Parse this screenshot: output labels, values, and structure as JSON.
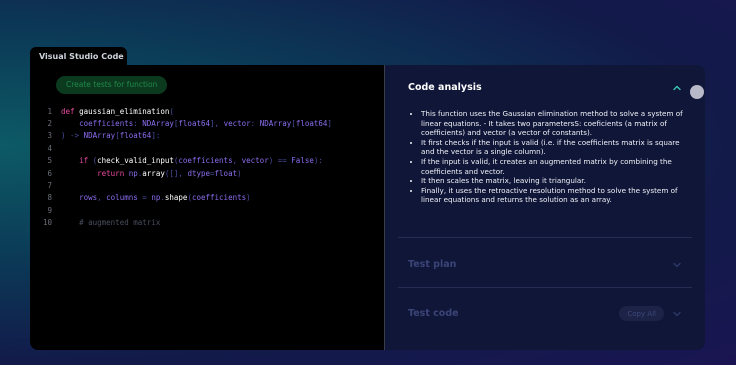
{
  "window": {
    "title": "Visual Studio Code"
  },
  "editor": {
    "create_button_label": "Create tests for function",
    "line_numbers": [
      "1",
      "2",
      "3",
      "4",
      "5",
      "6",
      "7",
      "8",
      "9",
      "10"
    ],
    "line1": {
      "kw": "def",
      "name": "gaussian_elimination",
      "paren": "("
    },
    "line2": {
      "p1": "coefficients",
      "c1": ":",
      "t1": "NDArray",
      "b1": "[",
      "t2": "float64",
      "b2": "]",
      "comma": ",",
      "p2": "vector",
      "c2": ":",
      "t3": "NDArray",
      "b3": "[",
      "t4": "float64",
      "b4": "]"
    },
    "line3": {
      "close": ")",
      "arrow": "->",
      "t1": "NDArray",
      "b1": "[",
      "t2": "float64",
      "b2": "]",
      "colon": ":"
    },
    "line5": {
      "kw": "if",
      "paren": "(",
      "fn": "check_valid_input",
      "p": "(",
      "a1": "coefficients",
      "comma": ",",
      "a2": "vector",
      "close": ")",
      "eq": "==",
      "val": "False",
      "end": "):"
    },
    "line6": {
      "kw": "return",
      "mod": "np",
      "dot": ".",
      "fn": "array",
      "args": "([],",
      "kw2": "dtype",
      "eq": "=",
      "val": "float",
      "end": ")"
    },
    "line8": {
      "a": "rows",
      "comma": ",",
      "b": "columns",
      "eq": "=",
      "mod": "np",
      "dot": ".",
      "fn": "shape",
      "p": "(",
      "arg": "coefficients",
      "end": ")"
    },
    "line10": {
      "comment": "# augmented matrix"
    }
  },
  "panel": {
    "analysis": {
      "title": "Code analysis",
      "bullets": [
        "This function uses the Gaussian elimination method to solve a system of linear equations. - It takes two parametersS: coeficients (a matrix of coefficients) and vector (a vector of constants).",
        "It first checks if the input is valid (i.e. if the coefficients matrix is square and the vector is a single column).",
        "If the input is valid, it creates an augmented matrix by combining the coefficients and vector.",
        "It then scales the matrix, leaving it triangular.",
        "Finally, it uses the retroactive resolution method to solve the system of linear equations and returns the solution as an array."
      ]
    },
    "test_plan": {
      "title": "Test plan"
    },
    "test_code": {
      "title": "Test code",
      "copy_label": "Copy All"
    }
  },
  "colors": {
    "accent_green": "#1f8a4c",
    "keyword_pink": "#e94aa0",
    "type_purple": "#8b6ef0",
    "panel_bg": "#0f1638",
    "chevron_teal": "#39c7b4"
  },
  "icons": [
    "chevron-up-icon",
    "chevron-down-icon",
    "scroll-handle"
  ]
}
